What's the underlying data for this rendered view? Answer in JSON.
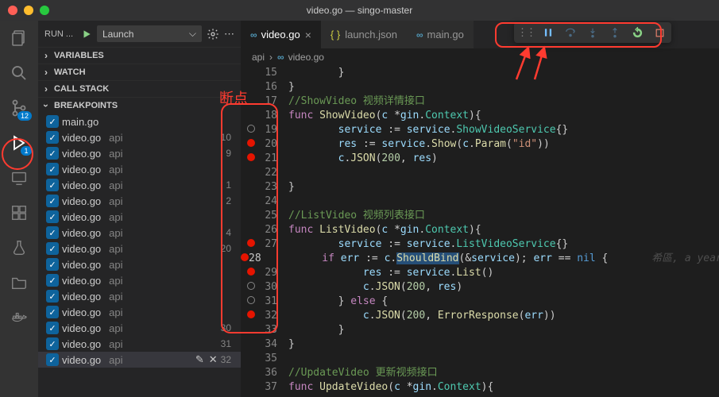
{
  "title": "video.go — singo-master",
  "run": {
    "label": "RUN ...",
    "config": "Launch"
  },
  "sections": [
    "VARIABLES",
    "WATCH",
    "CALL STACK",
    "BREAKPOINTS"
  ],
  "activity_badges": {
    "scm": "12",
    "debug": "1"
  },
  "breakpoints": [
    {
      "file": "main.go",
      "path": "",
      "line": ""
    },
    {
      "file": "video.go",
      "path": "api",
      "line": "10"
    },
    {
      "file": "video.go",
      "path": "api",
      "line": "9"
    },
    {
      "file": "video.go",
      "path": "api",
      "line": ""
    },
    {
      "file": "video.go",
      "path": "api",
      "line": "1"
    },
    {
      "file": "video.go",
      "path": "api",
      "line": "2"
    },
    {
      "file": "video.go",
      "path": "api",
      "line": ""
    },
    {
      "file": "video.go",
      "path": "api",
      "line": "4"
    },
    {
      "file": "video.go",
      "path": "api",
      "line": "20"
    },
    {
      "file": "video.go",
      "path": "api",
      "line": ""
    },
    {
      "file": "video.go",
      "path": "api",
      "line": ""
    },
    {
      "file": "video.go",
      "path": "api",
      "line": ""
    },
    {
      "file": "video.go",
      "path": "api",
      "line": ""
    },
    {
      "file": "video.go",
      "path": "api",
      "line": "30"
    },
    {
      "file": "video.go",
      "path": "api",
      "line": "31"
    },
    {
      "file": "video.go",
      "path": "api",
      "line": "32",
      "selected": true,
      "showActions": true
    }
  ],
  "tabs": [
    {
      "label": "video.go",
      "icon": "go",
      "active": true
    },
    {
      "label": "launch.json",
      "icon": "json",
      "active": false
    },
    {
      "label": "main.go",
      "icon": "go",
      "active": false,
      "truncated": true
    }
  ],
  "breadcrumb": {
    "root": "api",
    "file": "video.go"
  },
  "annotation_label": "断点",
  "blame": "希區, a year ago …",
  "code": [
    {
      "n": 15,
      "html": "        }"
    },
    {
      "n": 16,
      "html": "}"
    },
    {
      "n": 17,
      "html": "",
      "cm": "//ShowVideo 视频详情接口"
    },
    {
      "n": 18,
      "html": "<span class='kw'>func</span> <span class='fn'>ShowVideo</span>(<span class='id'>c</span> <span class='op'>*</span><span class='id'>gin</span>.<span class='ty'>Context</span>){"
    },
    {
      "n": 19,
      "bp": "ring",
      "html": "        <span class='id'>service</span> := <span class='id'>service</span>.<span class='ty'>ShowVideoService</span>{}"
    },
    {
      "n": 20,
      "bp": "dot",
      "html": "        <span class='id'>res</span> := <span class='id'>service</span>.<span class='fn'>Show</span>(<span class='id'>c</span>.<span class='fn'>Param</span>(<span class='str'>\"id\"</span>))"
    },
    {
      "n": 21,
      "bp": "dot",
      "html": "        <span class='id'>c</span>.<span class='fn'>JSON</span>(<span class='num'>200</span>, <span class='id'>res</span>)"
    },
    {
      "n": 22,
      "html": ""
    },
    {
      "n": 23,
      "html": "}"
    },
    {
      "n": 24,
      "html": ""
    },
    {
      "n": 25,
      "html": "",
      "cm": "//ListVideo 视频列表接口"
    },
    {
      "n": 26,
      "html": "<span class='kw'>func</span> <span class='fn'>ListVideo</span>(<span class='id'>c</span> <span class='op'>*</span><span class='id'>gin</span>.<span class='ty'>Context</span>){"
    },
    {
      "n": 27,
      "bp": "dot",
      "html": "        <span class='id'>service</span> := <span class='id'>service</span>.<span class='ty'>ListVideoService</span>{}"
    },
    {
      "n": 28,
      "bp": "dot",
      "cur": true,
      "html": "        <span class='kw'>if</span> <span class='id'>err</span> := <span class='id'>c</span>.<span class='sel'><span class='fn'>ShouldBind</span></span>(&amp;<span class='id'>service</span>); <span class='id'>err</span> == <span class='const'>nil</span> {",
      "blame": true
    },
    {
      "n": 29,
      "bp": "dot",
      "html": "            <span class='id'>res</span> := <span class='id'>service</span>.<span class='fn'>List</span>()"
    },
    {
      "n": 30,
      "bp": "ring",
      "html": "            <span class='id'>c</span>.<span class='fn'>JSON</span>(<span class='num'>200</span>, <span class='id'>res</span>)"
    },
    {
      "n": 31,
      "bp": "ring",
      "html": "        } <span class='kw'>else</span> {"
    },
    {
      "n": 32,
      "bp": "dot",
      "html": "            <span class='id'>c</span>.<span class='fn'>JSON</span>(<span class='num'>200</span>, <span class='fn'>ErrorResponse</span>(<span class='id'>err</span>))"
    },
    {
      "n": 33,
      "html": "        }"
    },
    {
      "n": 34,
      "html": "}"
    },
    {
      "n": 35,
      "html": ""
    },
    {
      "n": 36,
      "html": "",
      "cm": "//UpdateVideo 更新视频接口"
    },
    {
      "n": 37,
      "html": "<span class='kw'>func</span> <span class='fn'>UpdateVideo</span>(<span class='id'>c</span> <span class='op'>*</span><span class='id'>gin</span>.<span class='ty'>Context</span>){"
    }
  ]
}
